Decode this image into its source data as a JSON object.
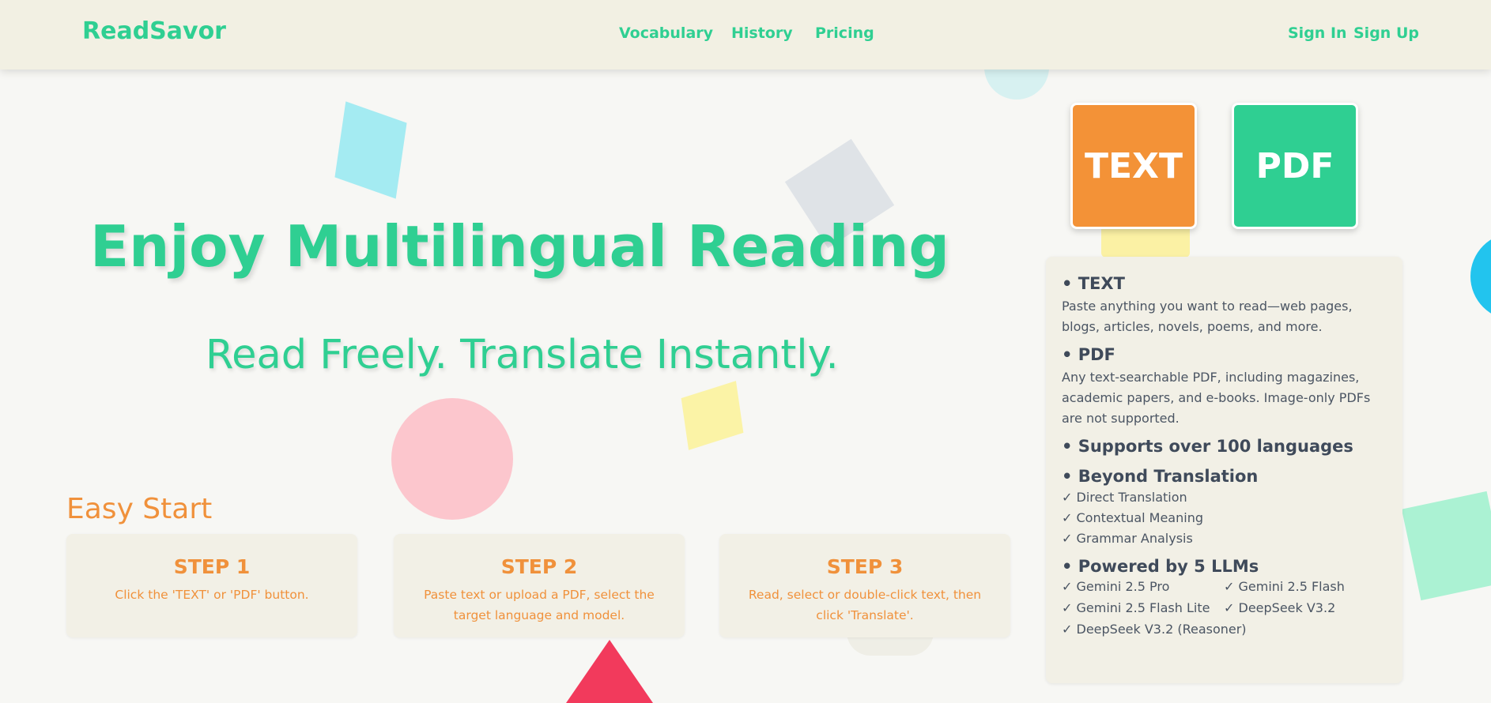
{
  "header": {
    "logo": "ReadSavor",
    "nav": [
      "Vocabulary",
      "History",
      "Pricing"
    ],
    "sign_in": "Sign In",
    "sign_up": "Sign Up"
  },
  "hero": {
    "title": "Enjoy Multilingual Reading",
    "subtitle": "Read Freely. Translate Instantly."
  },
  "easy_start": {
    "heading": "Easy Start",
    "steps": [
      {
        "title": "STEP 1",
        "desc": "Click the 'TEXT' or 'PDF' button."
      },
      {
        "title": "STEP 2",
        "desc": "Paste text or upload a PDF, select the target language and model."
      },
      {
        "title": "STEP 3",
        "desc": "Read, select or double-click text, then click 'Translate'."
      }
    ]
  },
  "mode_buttons": {
    "text": "TEXT",
    "pdf": "PDF"
  },
  "panel": {
    "text_head": "• TEXT",
    "text_desc": "Paste anything you want to read—web pages, blogs, articles, novels, poems, and more.",
    "pdf_head": "• PDF",
    "pdf_desc": "Any text-searchable PDF, including magazines, academic papers, and e-books. Image-only PDFs are not supported.",
    "languages_head": "• Supports over 100 languages",
    "beyond_head": "• Beyond Translation",
    "beyond_items": [
      "✓ Direct Translation",
      "✓ Contextual Meaning",
      "✓ Grammar Analysis"
    ],
    "llms_head": "• Powered by 5 LLMs",
    "llm_items": [
      "✓ Gemini 2.5 Pro",
      "✓ Gemini 2.5 Flash",
      "✓ Gemini 2.5 Flash Lite",
      "✓ DeepSeek V3.2",
      "✓ DeepSeek V3.2 (Reasoner)"
    ]
  },
  "colors": {
    "brand_green": "#2fcf92",
    "accent_orange": "#f0913b",
    "header_bg": "#f2f0e3"
  }
}
